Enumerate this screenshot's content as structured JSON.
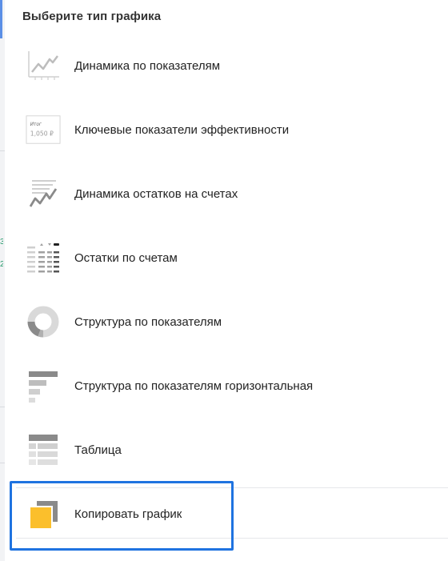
{
  "dialog": {
    "title": "Выберите тип графика"
  },
  "chart_types": [
    {
      "label": "Динамика по показателям",
      "icon": "line-chart-icon"
    },
    {
      "label": "Ключевые показатели эффективности",
      "icon": "kpi-card-icon",
      "icon_caption": "Итог",
      "icon_value": "1,050 ₽"
    },
    {
      "label": "Динамика остатков на счетах",
      "icon": "balance-trend-icon"
    },
    {
      "label": "Остатки по счетам",
      "icon": "account-balances-icon"
    },
    {
      "label": "Структура по показателям",
      "icon": "donut-chart-icon"
    },
    {
      "label": "Структура по показателям горизонтальная",
      "icon": "horizontal-bars-icon"
    },
    {
      "label": "Таблица",
      "icon": "table-icon"
    }
  ],
  "copy_action": {
    "label": "Копировать график",
    "icon": "copy-chart-icon",
    "accent_color": "#fbbf2c"
  },
  "colors": {
    "highlight": "#1f73e0",
    "icon_gray": "#8a8a8a",
    "icon_light": "#cfcfcf"
  }
}
